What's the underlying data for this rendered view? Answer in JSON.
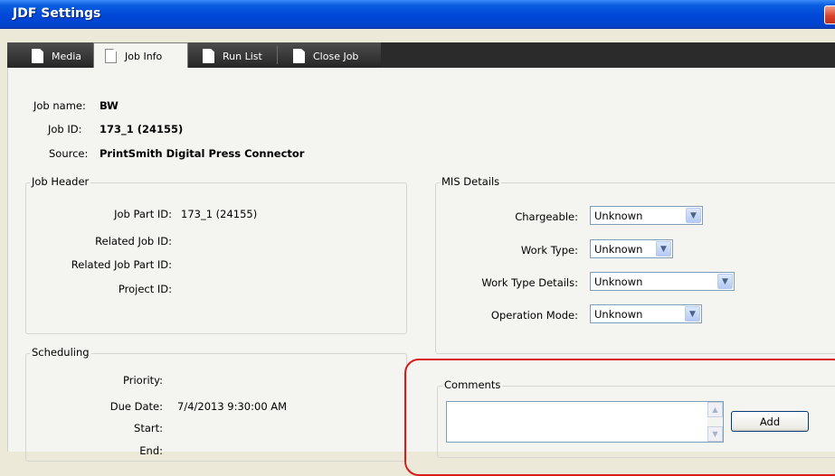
{
  "window": {
    "title": "JDF Settings"
  },
  "tabs": [
    {
      "label": "Media"
    },
    {
      "label": "Job Info"
    },
    {
      "label": "Run List"
    },
    {
      "label": "Close Job"
    }
  ],
  "job": {
    "name_label": "Job name:",
    "name_value": "BW",
    "id_label": "Job ID:",
    "id_value": "173_1  (24155)",
    "source_label": "Source:",
    "source_value": "PrintSmith Digital Press Connector"
  },
  "job_header": {
    "title": "Job Header",
    "part_id_label": "Job Part ID:",
    "part_id_value": "173_1  (24155)",
    "related_job_id_label": "Related Job ID:",
    "related_job_part_id_label": "Related Job Part ID:",
    "project_id_label": "Project ID:"
  },
  "mis_details": {
    "title": "MIS Details",
    "chargeable_label": "Chargeable:",
    "chargeable_value": "Unknown",
    "work_type_label": "Work Type:",
    "work_type_value": "Unknown",
    "work_type_details_label": "Work Type Details:",
    "work_type_details_value": "Unknown",
    "operation_mode_label": "Operation Mode:",
    "operation_mode_value": "Unknown"
  },
  "scheduling": {
    "title": "Scheduling",
    "priority_label": "Priority:",
    "due_date_label": "Due Date:",
    "due_date_value": "7/4/2013 9:30:00 AM",
    "start_label": "Start:",
    "end_label": "End:"
  },
  "comments": {
    "title": "Comments",
    "value": "",
    "add_label": "Add"
  },
  "colors": {
    "titlebar": "#0048d8",
    "highlight": "#d81b1b"
  }
}
